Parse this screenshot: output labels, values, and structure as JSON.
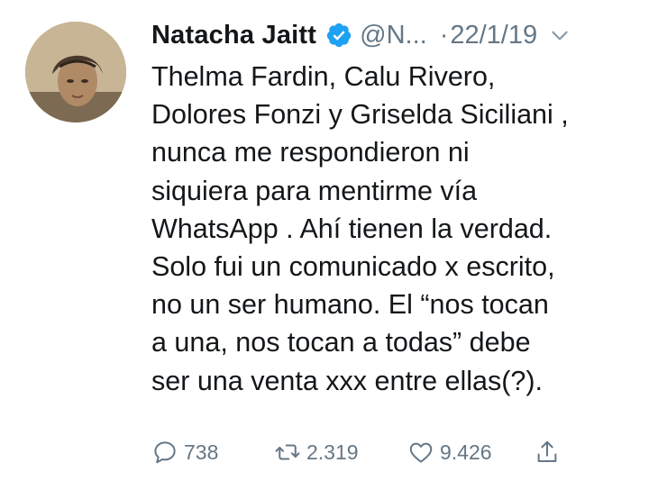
{
  "tweet": {
    "author_name": "Natacha Jaitt",
    "handle": "@N...",
    "separator": "·",
    "date": "22/1/19",
    "text": "Thelma Fardin, Calu Rivero,\nDolores Fonzi y Griselda Siciliani ,\nnunca me respondieron ni\nsiquiera para mentirme vía\nWhatsApp . Ahí tienen la verdad.\nSolo fui un comunicado x escrito,\nno un ser humano. El “nos tocan\na una, nos tocan a todas” debe\nser una venta xxx entre ellas(?).",
    "verified": true
  },
  "actions": {
    "replies": "738",
    "retweets": "2.319",
    "likes": "9.426"
  },
  "colors": {
    "verified": "#1da1f2",
    "secondary_text": "#657786",
    "primary_text": "#14171a"
  },
  "icons": [
    "verified-badge-icon",
    "chevron-down-icon",
    "reply-icon",
    "retweet-icon",
    "like-icon",
    "share-icon"
  ]
}
